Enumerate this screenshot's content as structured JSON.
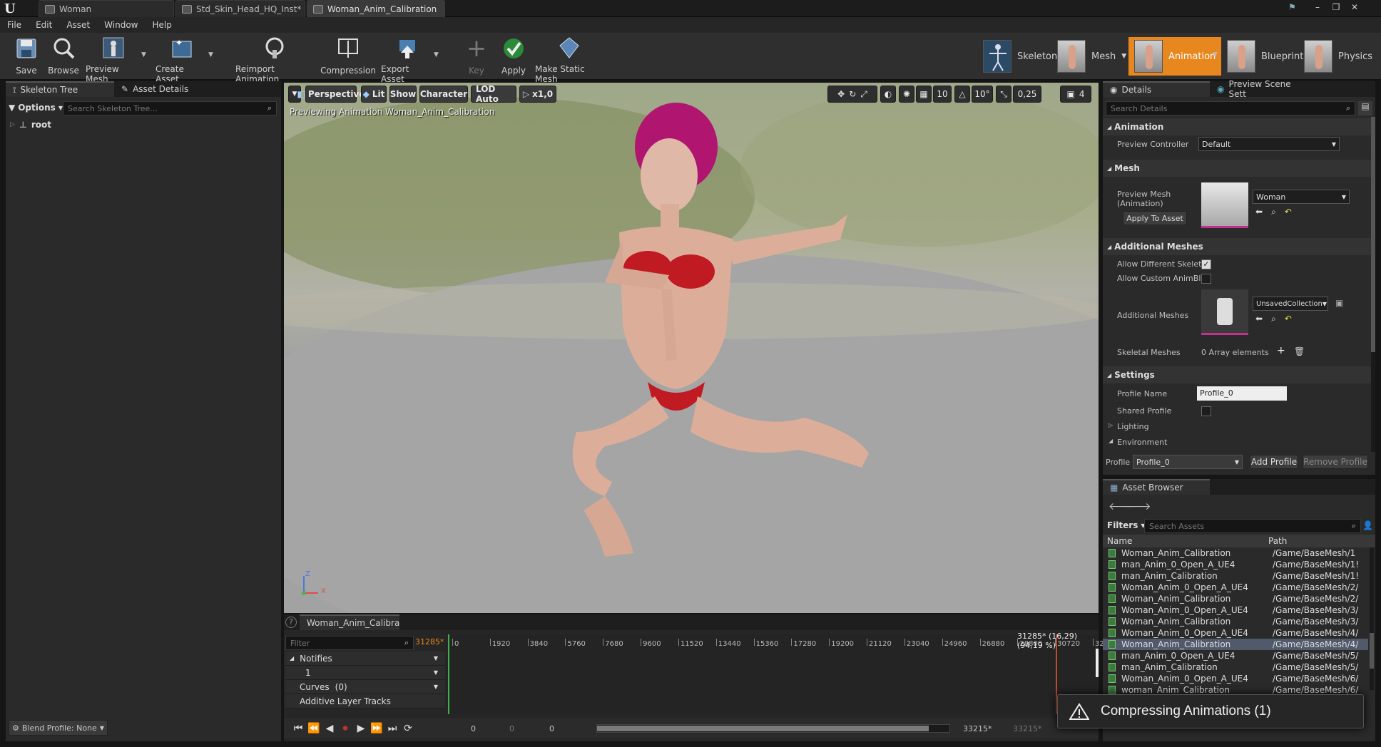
{
  "titlebar": {
    "tabs": [
      {
        "label": "Woman"
      },
      {
        "label": "Std_Skin_Head_HQ_Inst*"
      },
      {
        "label": "Woman_Anim_Calibration"
      }
    ]
  },
  "menu": {
    "items": [
      "File",
      "Edit",
      "Asset",
      "Window",
      "Help"
    ]
  },
  "toolbar": {
    "save": "Save",
    "browse": "Browse",
    "preview_mesh": "Preview Mesh",
    "create_asset": "Create Asset",
    "reimport": "Reimport Animation",
    "compression": "Compression",
    "export_asset": "Export Asset",
    "key": "Key",
    "apply": "Apply",
    "make_static_mesh": "Make Static Mesh"
  },
  "modes": {
    "skeleton": "Skeleton",
    "mesh": "Mesh",
    "animation": "Animation",
    "blueprint": "Blueprint",
    "physics": "Physics"
  },
  "skeleton_panel": {
    "tab_skeleton_tree": "Skeleton Tree",
    "tab_asset_details": "Asset Details",
    "options": "Options",
    "search_placeholder": "Search Skeleton Tree...",
    "root": "root",
    "blend_profile": "Blend Profile: None"
  },
  "viewport": {
    "perspective": "Perspective",
    "lit": "Lit",
    "show": "Show",
    "character": "Character",
    "lod": "LOD Auto",
    "speed": "x1,0",
    "grid_snap": "10",
    "rot_snap": "10°",
    "scale_snap": "0,25",
    "cam_speed": "4",
    "previewing": "Previewing Animation Woman_Anim_Calibration",
    "axis_z": "Z",
    "axis_x": "X"
  },
  "timeline": {
    "tab": "Woman_Anim_Calibra",
    "filter_placeholder": "Filter",
    "current_frame": "31285*",
    "readout": "31285* (16,29) (94,19 %)",
    "ticks": [
      "0",
      "1920",
      "3840",
      "5760",
      "7680",
      "9600",
      "11520",
      "13440",
      "15360",
      "17280",
      "19200",
      "21120",
      "23040",
      "24960",
      "26880",
      "28800",
      "30720",
      "32"
    ],
    "tracks": {
      "notifies": "Notifies",
      "notify_1": "1",
      "curves": "Curves",
      "curves_count": "(0)",
      "additive": "Additive Layer Tracks"
    },
    "range_start": "0",
    "range_a": "0",
    "range_b": "0",
    "end_frame": "33215*",
    "end_frame_b": "33215*",
    "progress": 0.9419
  },
  "details": {
    "tab_details": "Details",
    "tab_preview": "Preview Scene Sett",
    "search_placeholder": "Search Details",
    "animation_section": "Animation",
    "preview_controller_label": "Preview Controller",
    "preview_controller_value": "Default",
    "mesh_section": "Mesh",
    "preview_mesh_label": "Preview Mesh (Animation)",
    "preview_mesh_value": "Woman",
    "apply_to_asset": "Apply To Asset",
    "additional_section": "Additional Meshes",
    "allow_different": "Allow Different Skelet",
    "allow_custom": "Allow Custom AnimBl",
    "additional_meshes_label": "Additional Meshes",
    "additional_value": "UnsavedCollection",
    "skeletal_meshes_label": "Skeletal Meshes",
    "skeletal_meshes_value": "0 Array elements",
    "settings_section": "Settings",
    "profile_name_label": "Profile Name",
    "profile_name_value": "Profile_0",
    "shared_profile_label": "Shared Profile",
    "lighting": "Lighting",
    "environment": "Environment",
    "profile_label": "Profile",
    "profile_value": "Profile_0",
    "add_profile": "Add Profile",
    "remove_profile": "Remove Profile"
  },
  "asset_browser": {
    "tab": "Asset Browser",
    "filters": "Filters",
    "search_placeholder": "Search Assets",
    "col_name": "Name",
    "col_path": "Path",
    "rows": [
      {
        "name": "Woman_Anim_Calibration",
        "path": "/Game/BaseMesh/1"
      },
      {
        "name": "man_Anim_0_Open_A_UE4",
        "path": "/Game/BaseMesh/1!"
      },
      {
        "name": "man_Anim_Calibration",
        "path": "/Game/BaseMesh/1!"
      },
      {
        "name": "Woman_Anim_0_Open_A_UE4",
        "path": "/Game/BaseMesh/2/"
      },
      {
        "name": "Woman_Anim_Calibration",
        "path": "/Game/BaseMesh/2/"
      },
      {
        "name": "Woman_Anim_0_Open_A_UE4",
        "path": "/Game/BaseMesh/3/"
      },
      {
        "name": "Woman_Anim_Calibration",
        "path": "/Game/BaseMesh/3/"
      },
      {
        "name": "Woman_Anim_0_Open_A_UE4",
        "path": "/Game/BaseMesh/4/"
      },
      {
        "name": "Woman_Anim_Calibration",
        "path": "/Game/BaseMesh/4/"
      },
      {
        "name": "man_Anim_0_Open_A_UE4",
        "path": "/Game/BaseMesh/5/"
      },
      {
        "name": "man_Anim_Calibration",
        "path": "/Game/BaseMesh/5/"
      },
      {
        "name": "Woman_Anim_0_Open_A_UE4",
        "path": "/Game/BaseMesh/6/"
      },
      {
        "name": "woman_Anim_Calibration",
        "path": "/Game/BaseMesh/6/"
      }
    ]
  },
  "notification": {
    "text": "Compressing Animations (1)"
  }
}
